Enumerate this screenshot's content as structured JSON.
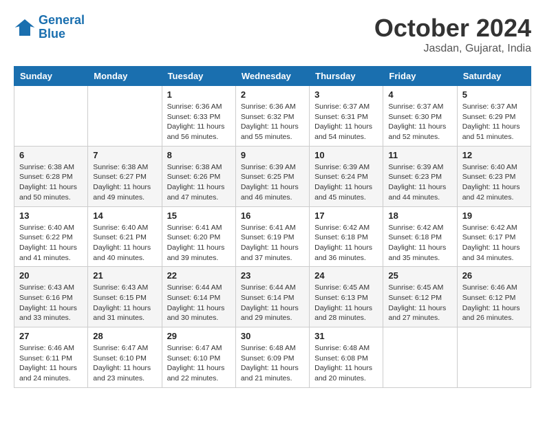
{
  "header": {
    "logo_line1": "General",
    "logo_line2": "Blue",
    "month": "October 2024",
    "location": "Jasdan, Gujarat, India"
  },
  "days_of_week": [
    "Sunday",
    "Monday",
    "Tuesday",
    "Wednesday",
    "Thursday",
    "Friday",
    "Saturday"
  ],
  "weeks": [
    [
      {
        "day": "",
        "sunrise": "",
        "sunset": "",
        "daylight": ""
      },
      {
        "day": "",
        "sunrise": "",
        "sunset": "",
        "daylight": ""
      },
      {
        "day": "1",
        "sunrise": "Sunrise: 6:36 AM",
        "sunset": "Sunset: 6:33 PM",
        "daylight": "Daylight: 11 hours and 56 minutes."
      },
      {
        "day": "2",
        "sunrise": "Sunrise: 6:36 AM",
        "sunset": "Sunset: 6:32 PM",
        "daylight": "Daylight: 11 hours and 55 minutes."
      },
      {
        "day": "3",
        "sunrise": "Sunrise: 6:37 AM",
        "sunset": "Sunset: 6:31 PM",
        "daylight": "Daylight: 11 hours and 54 minutes."
      },
      {
        "day": "4",
        "sunrise": "Sunrise: 6:37 AM",
        "sunset": "Sunset: 6:30 PM",
        "daylight": "Daylight: 11 hours and 52 minutes."
      },
      {
        "day": "5",
        "sunrise": "Sunrise: 6:37 AM",
        "sunset": "Sunset: 6:29 PM",
        "daylight": "Daylight: 11 hours and 51 minutes."
      }
    ],
    [
      {
        "day": "6",
        "sunrise": "Sunrise: 6:38 AM",
        "sunset": "Sunset: 6:28 PM",
        "daylight": "Daylight: 11 hours and 50 minutes."
      },
      {
        "day": "7",
        "sunrise": "Sunrise: 6:38 AM",
        "sunset": "Sunset: 6:27 PM",
        "daylight": "Daylight: 11 hours and 49 minutes."
      },
      {
        "day": "8",
        "sunrise": "Sunrise: 6:38 AM",
        "sunset": "Sunset: 6:26 PM",
        "daylight": "Daylight: 11 hours and 47 minutes."
      },
      {
        "day": "9",
        "sunrise": "Sunrise: 6:39 AM",
        "sunset": "Sunset: 6:25 PM",
        "daylight": "Daylight: 11 hours and 46 minutes."
      },
      {
        "day": "10",
        "sunrise": "Sunrise: 6:39 AM",
        "sunset": "Sunset: 6:24 PM",
        "daylight": "Daylight: 11 hours and 45 minutes."
      },
      {
        "day": "11",
        "sunrise": "Sunrise: 6:39 AM",
        "sunset": "Sunset: 6:23 PM",
        "daylight": "Daylight: 11 hours and 44 minutes."
      },
      {
        "day": "12",
        "sunrise": "Sunrise: 6:40 AM",
        "sunset": "Sunset: 6:23 PM",
        "daylight": "Daylight: 11 hours and 42 minutes."
      }
    ],
    [
      {
        "day": "13",
        "sunrise": "Sunrise: 6:40 AM",
        "sunset": "Sunset: 6:22 PM",
        "daylight": "Daylight: 11 hours and 41 minutes."
      },
      {
        "day": "14",
        "sunrise": "Sunrise: 6:40 AM",
        "sunset": "Sunset: 6:21 PM",
        "daylight": "Daylight: 11 hours and 40 minutes."
      },
      {
        "day": "15",
        "sunrise": "Sunrise: 6:41 AM",
        "sunset": "Sunset: 6:20 PM",
        "daylight": "Daylight: 11 hours and 39 minutes."
      },
      {
        "day": "16",
        "sunrise": "Sunrise: 6:41 AM",
        "sunset": "Sunset: 6:19 PM",
        "daylight": "Daylight: 11 hours and 37 minutes."
      },
      {
        "day": "17",
        "sunrise": "Sunrise: 6:42 AM",
        "sunset": "Sunset: 6:18 PM",
        "daylight": "Daylight: 11 hours and 36 minutes."
      },
      {
        "day": "18",
        "sunrise": "Sunrise: 6:42 AM",
        "sunset": "Sunset: 6:18 PM",
        "daylight": "Daylight: 11 hours and 35 minutes."
      },
      {
        "day": "19",
        "sunrise": "Sunrise: 6:42 AM",
        "sunset": "Sunset: 6:17 PM",
        "daylight": "Daylight: 11 hours and 34 minutes."
      }
    ],
    [
      {
        "day": "20",
        "sunrise": "Sunrise: 6:43 AM",
        "sunset": "Sunset: 6:16 PM",
        "daylight": "Daylight: 11 hours and 33 minutes."
      },
      {
        "day": "21",
        "sunrise": "Sunrise: 6:43 AM",
        "sunset": "Sunset: 6:15 PM",
        "daylight": "Daylight: 11 hours and 31 minutes."
      },
      {
        "day": "22",
        "sunrise": "Sunrise: 6:44 AM",
        "sunset": "Sunset: 6:14 PM",
        "daylight": "Daylight: 11 hours and 30 minutes."
      },
      {
        "day": "23",
        "sunrise": "Sunrise: 6:44 AM",
        "sunset": "Sunset: 6:14 PM",
        "daylight": "Daylight: 11 hours and 29 minutes."
      },
      {
        "day": "24",
        "sunrise": "Sunrise: 6:45 AM",
        "sunset": "Sunset: 6:13 PM",
        "daylight": "Daylight: 11 hours and 28 minutes."
      },
      {
        "day": "25",
        "sunrise": "Sunrise: 6:45 AM",
        "sunset": "Sunset: 6:12 PM",
        "daylight": "Daylight: 11 hours and 27 minutes."
      },
      {
        "day": "26",
        "sunrise": "Sunrise: 6:46 AM",
        "sunset": "Sunset: 6:12 PM",
        "daylight": "Daylight: 11 hours and 26 minutes."
      }
    ],
    [
      {
        "day": "27",
        "sunrise": "Sunrise: 6:46 AM",
        "sunset": "Sunset: 6:11 PM",
        "daylight": "Daylight: 11 hours and 24 minutes."
      },
      {
        "day": "28",
        "sunrise": "Sunrise: 6:47 AM",
        "sunset": "Sunset: 6:10 PM",
        "daylight": "Daylight: 11 hours and 23 minutes."
      },
      {
        "day": "29",
        "sunrise": "Sunrise: 6:47 AM",
        "sunset": "Sunset: 6:10 PM",
        "daylight": "Daylight: 11 hours and 22 minutes."
      },
      {
        "day": "30",
        "sunrise": "Sunrise: 6:48 AM",
        "sunset": "Sunset: 6:09 PM",
        "daylight": "Daylight: 11 hours and 21 minutes."
      },
      {
        "day": "31",
        "sunrise": "Sunrise: 6:48 AM",
        "sunset": "Sunset: 6:08 PM",
        "daylight": "Daylight: 11 hours and 20 minutes."
      },
      {
        "day": "",
        "sunrise": "",
        "sunset": "",
        "daylight": ""
      },
      {
        "day": "",
        "sunrise": "",
        "sunset": "",
        "daylight": ""
      }
    ]
  ]
}
